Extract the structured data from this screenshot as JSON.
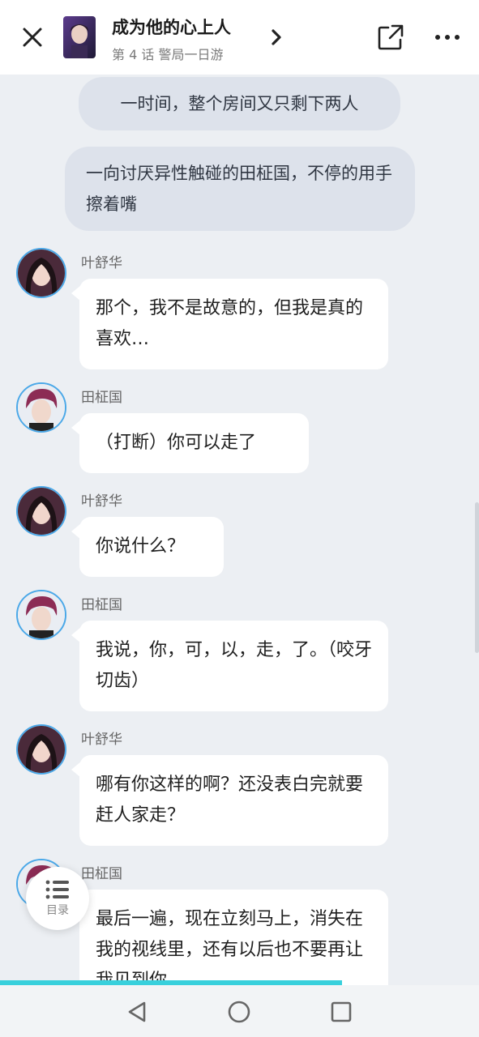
{
  "header": {
    "title": "成为他的心上人",
    "subtitle": "第 4 话  警局一日游"
  },
  "narrations": [
    "一时间，整个房间又只剩下两人",
    "一向讨厌异性触碰的田柾国，不停的用手擦着嘴"
  ],
  "messages": [
    {
      "name": "叶舒华",
      "text": "那个，我不是故意的，但我是真的喜欢…"
    },
    {
      "name": "田柾国",
      "text": "（打断）你可以走了"
    },
    {
      "name": "叶舒华",
      "text": "你说什么？"
    },
    {
      "name": "田柾国",
      "text": "我说，你，可，以，走，了。（咬牙切齿）"
    },
    {
      "name": "叶舒华",
      "text": "哪有你这样的啊？还没表白完就要赶人家走？"
    },
    {
      "name": "田柾国",
      "text": "最后一遍，现在立刻马上，消失在我的视线里，还有以后也不要再让我见到你"
    }
  ],
  "toc": {
    "label": "目录"
  },
  "reading_progress": 0.714,
  "colors": {
    "accent": "#38d0dc",
    "avatar_border": "#4aa8e8",
    "narration_bg": "#dde2eb",
    "page_bg": "#eceff3"
  },
  "icons": [
    "close-icon",
    "chevron-right-icon",
    "share-icon",
    "more-icon",
    "list-icon",
    "back-triangle-icon",
    "home-circle-icon",
    "recent-square-icon"
  ]
}
